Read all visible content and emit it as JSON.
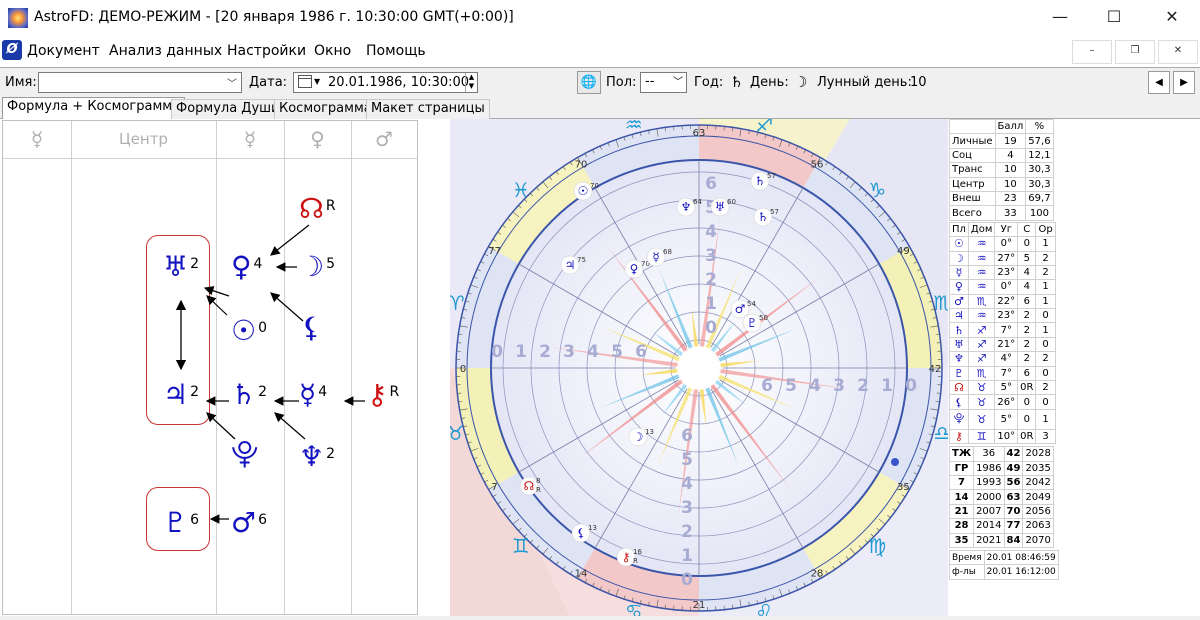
{
  "window": {
    "title": "AstroFD: ДЕМО-РЕЖИМ - [20 января 1986 г. 10:30:00 GMT(+0:00)]",
    "minimize": "—",
    "maximize": "☐",
    "close": "✕"
  },
  "menu": {
    "items": [
      "Документ",
      "Анализ данных",
      "Настройки",
      "Окно",
      "Помощь"
    ],
    "mdi_minimize": "–",
    "mdi_restore": "❐",
    "mdi_close": "✕"
  },
  "toolbar": {
    "name_label": "Имя:",
    "name_value": "",
    "date_label": "Дата:",
    "date_value": "20.01.1986, 10:30:00",
    "gender_label": "Пол:",
    "gender_value": "--",
    "year_label": "Год:",
    "year_symbol": "♄",
    "day_label": "День:",
    "day_symbol": "☽",
    "lunar_day_label": "Лунный день:",
    "lunar_day_value": "10",
    "prev": "◀",
    "next": "▶"
  },
  "tabs": [
    "Формула + Космограмма",
    "Формула Души",
    "Космограмма",
    "Макет страницы"
  ],
  "formula": {
    "columns": [
      "☿",
      "Центр",
      "☿",
      "♀",
      "♂"
    ],
    "planets": {
      "uranus": {
        "glyph": "♅",
        "num": "2"
      },
      "jupiter": {
        "glyph": "♃",
        "num": "2"
      },
      "pluto_frame": {
        "glyph": "♇",
        "num": "6"
      },
      "venus": {
        "glyph": "♀",
        "num": "4"
      },
      "sun": {
        "glyph": "☉",
        "num": "0"
      },
      "saturn": {
        "glyph": "♄",
        "num": "2"
      },
      "proserpina": {
        "glyph": "⯓",
        "num": ""
      },
      "mars": {
        "glyph": "♂",
        "num": "6"
      },
      "node": {
        "glyph": "☊",
        "num": "R"
      },
      "moon": {
        "glyph": "☽",
        "num": "5"
      },
      "lilith": {
        "glyph": "⚸",
        "num": ""
      },
      "mercury": {
        "glyph": "☿",
        "num": "4"
      },
      "neptune": {
        "glyph": "♆",
        "num": "2"
      },
      "chiron": {
        "glyph": "⚷",
        "num": "R"
      }
    }
  },
  "cosmogram": {
    "degree_labels": [
      "63",
      "56",
      "49",
      "42",
      "35",
      "28",
      "21",
      "14",
      "7",
      "0",
      "77",
      "70"
    ],
    "zodiac": [
      "♒",
      "♐",
      "♑",
      "♏",
      "♎",
      "♍",
      "♌",
      "♋",
      "♊",
      "♉",
      "♈",
      "♓"
    ],
    "left_scale": [
      "0",
      "1",
      "2",
      "3",
      "4",
      "5",
      "6"
    ],
    "right_scale": [
      "6",
      "5",
      "4",
      "3",
      "2",
      "1",
      "0"
    ],
    "top_scale": [
      "6",
      "5",
      "4",
      "3",
      "2",
      "1",
      "0"
    ],
    "bottom_scale": [
      "6",
      "5",
      "4",
      "3",
      "2",
      "1",
      "0"
    ],
    "chart_planets": [
      {
        "glyph": "☉",
        "num": "70"
      },
      {
        "glyph": "♆",
        "num": "64"
      },
      {
        "glyph": "♅",
        "num": "60"
      },
      {
        "glyph": "♄",
        "num": "57"
      },
      {
        "glyph": "♄",
        "num": "57"
      },
      {
        "glyph": "♃",
        "num": "75"
      },
      {
        "glyph": "♀",
        "num": "70"
      },
      {
        "glyph": "☿",
        "num": "68"
      },
      {
        "glyph": "♂",
        "num": "54"
      },
      {
        "glyph": "♇",
        "num": "50"
      },
      {
        "glyph": "☽",
        "num": "13"
      },
      {
        "glyph": "☊",
        "num": "8",
        "sub": "R"
      },
      {
        "glyph": "⚸",
        "num": "13"
      },
      {
        "glyph": "⚷",
        "num": "16",
        "sub": "R"
      }
    ]
  },
  "score_table": {
    "headers": [
      "",
      "Балл",
      "%"
    ],
    "rows": [
      [
        "Личные",
        "19",
        "57,6"
      ],
      [
        "Соц",
        "4",
        "12,1"
      ],
      [
        "Транс",
        "10",
        "30,3"
      ],
      [
        "Центр",
        "10",
        "30,3"
      ],
      [
        "Внеш",
        "23",
        "69,7"
      ],
      [
        "Всего",
        "33",
        "100"
      ]
    ]
  },
  "planet_table": {
    "headers": [
      "Пл",
      "Дом",
      "Уг",
      "С",
      "Ор"
    ],
    "rows": [
      {
        "pl": "☉",
        "dom": "♒",
        "ug": "0°",
        "s": "0",
        "or": "1"
      },
      {
        "pl": "☽",
        "dom": "♒",
        "ug": "27°",
        "s": "5",
        "or": "2"
      },
      {
        "pl": "☿",
        "dom": "♒",
        "ug": "23°",
        "s": "4",
        "or": "2"
      },
      {
        "pl": "♀",
        "dom": "♒",
        "ug": "0°",
        "s": "4",
        "or": "1"
      },
      {
        "pl": "♂",
        "dom": "♏",
        "ug": "22°",
        "s": "6",
        "or": "1"
      },
      {
        "pl": "♃",
        "dom": "♒",
        "ug": "23°",
        "s": "2",
        "or": "0"
      },
      {
        "pl": "♄",
        "dom": "♐",
        "ug": "7°",
        "s": "2",
        "or": "1"
      },
      {
        "pl": "♅",
        "dom": "♐",
        "ug": "21°",
        "s": "2",
        "or": "0"
      },
      {
        "pl": "♆",
        "dom": "♐",
        "ug": "4°",
        "s": "2",
        "or": "2"
      },
      {
        "pl": "♇",
        "dom": "♏",
        "ug": "7°",
        "s": "6",
        "or": "0"
      },
      {
        "pl": "☊",
        "dom": "♉",
        "ug": "5°",
        "s": "0R",
        "or": "2",
        "red": true
      },
      {
        "pl": "⚸",
        "dom": "♉",
        "ug": "26°",
        "s": "0",
        "or": "0"
      },
      {
        "pl": "⯓",
        "dom": "♉",
        "ug": "5°",
        "s": "0",
        "or": "1"
      },
      {
        "pl": "⚷",
        "dom": "♊",
        "ug": "10°",
        "s": "0R",
        "or": "3",
        "red": true
      }
    ]
  },
  "years_table": {
    "header": [
      "ТЖ",
      "36",
      "42",
      "2028"
    ],
    "rows": [
      [
        "ГР",
        "1986",
        "49",
        "2035"
      ],
      [
        "7",
        "1993",
        "56",
        "2042"
      ],
      [
        "14",
        "2000",
        "63",
        "2049"
      ],
      [
        "21",
        "2007",
        "70",
        "2056"
      ],
      [
        "28",
        "2014",
        "77",
        "2063"
      ],
      [
        "35",
        "2021",
        "84",
        "2070"
      ]
    ]
  },
  "footer_table": {
    "rows": [
      [
        "Время",
        "20.01 08:46:59"
      ],
      [
        "ф-лы",
        "20.01 16:12:00"
      ]
    ]
  },
  "colors": {
    "planet_blue": "#1212c0",
    "retro_red": "#cc1111",
    "frame_red": "#cc3333",
    "ring_blue": "#3a55aa"
  }
}
